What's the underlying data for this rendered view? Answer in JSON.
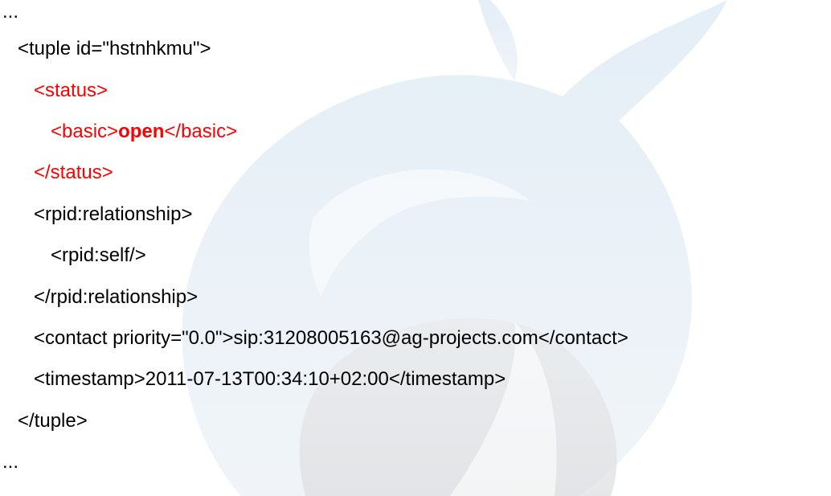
{
  "colors": {
    "text": "#000000",
    "highlight": "#ff0000",
    "background": "#ffffff",
    "watermark": "#dbe8f3"
  },
  "watermark": {
    "icon": "flame-logo-watermark"
  },
  "lines": {
    "ellipsis_top": "...",
    "tuple_open": "<tuple id=\"hstnhkmu\">",
    "status_open": "<status>",
    "basic_open": "<basic>",
    "basic_value": "open",
    "basic_close": "</basic>",
    "status_close": "</status>",
    "relationship_open": "<rpid:relationship>",
    "self": "<rpid:self/>",
    "relationship_close": "</rpid:relationship>",
    "contact": "<contact priority=\"0.0\">sip:31208005163@ag-projects.com</contact>",
    "timestamp": "<timestamp>2011-07-13T00:34:10+02:00</timestamp>",
    "tuple_close": "</tuple>",
    "ellipsis_bottom": "..."
  }
}
